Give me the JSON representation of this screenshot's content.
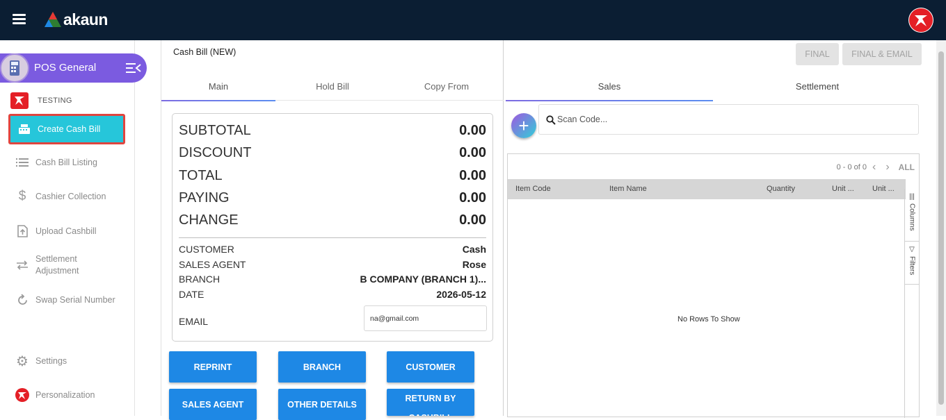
{
  "app": {
    "logo_text": "akaun"
  },
  "sidebar": {
    "module_title": "POS General",
    "company": "TESTING",
    "items": [
      {
        "label": "Create Cash Bill"
      },
      {
        "label": "Cash Bill Listing"
      },
      {
        "label": "Cashier Collection"
      },
      {
        "label": "Upload Cashbill"
      },
      {
        "label": "Settlement Adjustment"
      },
      {
        "label": "Swap Serial Number"
      },
      {
        "label": "Settings"
      },
      {
        "label": "Personalization"
      }
    ]
  },
  "bill": {
    "title": "Cash Bill (NEW)",
    "tabs": [
      "Main",
      "Hold Bill",
      "Copy From"
    ],
    "summary": [
      {
        "label": "SUBTOTAL",
        "value": "0.00"
      },
      {
        "label": "DISCOUNT",
        "value": "0.00"
      },
      {
        "label": "TOTAL",
        "value": "0.00"
      },
      {
        "label": "PAYING",
        "value": "0.00"
      },
      {
        "label": "CHANGE",
        "value": "0.00"
      }
    ],
    "info": [
      {
        "label": "CUSTOMER",
        "value": "Cash"
      },
      {
        "label": "SALES AGENT",
        "value": "Rose"
      },
      {
        "label": "BRANCH",
        "value": "B COMPANY (BRANCH 1)..."
      },
      {
        "label": "DATE",
        "value": "2026-05-12"
      }
    ],
    "email_label": "EMAIL",
    "email_value": "na@gmail.com",
    "buttons": [
      "REPRINT",
      "BRANCH",
      "CUSTOMER",
      "SALES AGENT",
      "OTHER DETAILS",
      "RETURN BY CASHBILL"
    ]
  },
  "right": {
    "final_label": "FINAL",
    "final_email_label": "FINAL & EMAIL",
    "tabs": [
      "Sales",
      "Settlement"
    ],
    "scan_placeholder": "Scan Code...",
    "pager": {
      "text": "0 - 0 of 0",
      "all": "ALL"
    },
    "columns": [
      "Item Code",
      "Item Name",
      "Quantity",
      "Unit ...",
      "Unit ..."
    ],
    "side_tabs": [
      "Columns",
      "Filters"
    ],
    "empty_text": "No Rows To Show"
  },
  "colors": {
    "topbar": "#0b1e33",
    "accent_purple": "#7b5be0",
    "active_nav": "#26c6da",
    "primary_button": "#1e88e5"
  }
}
